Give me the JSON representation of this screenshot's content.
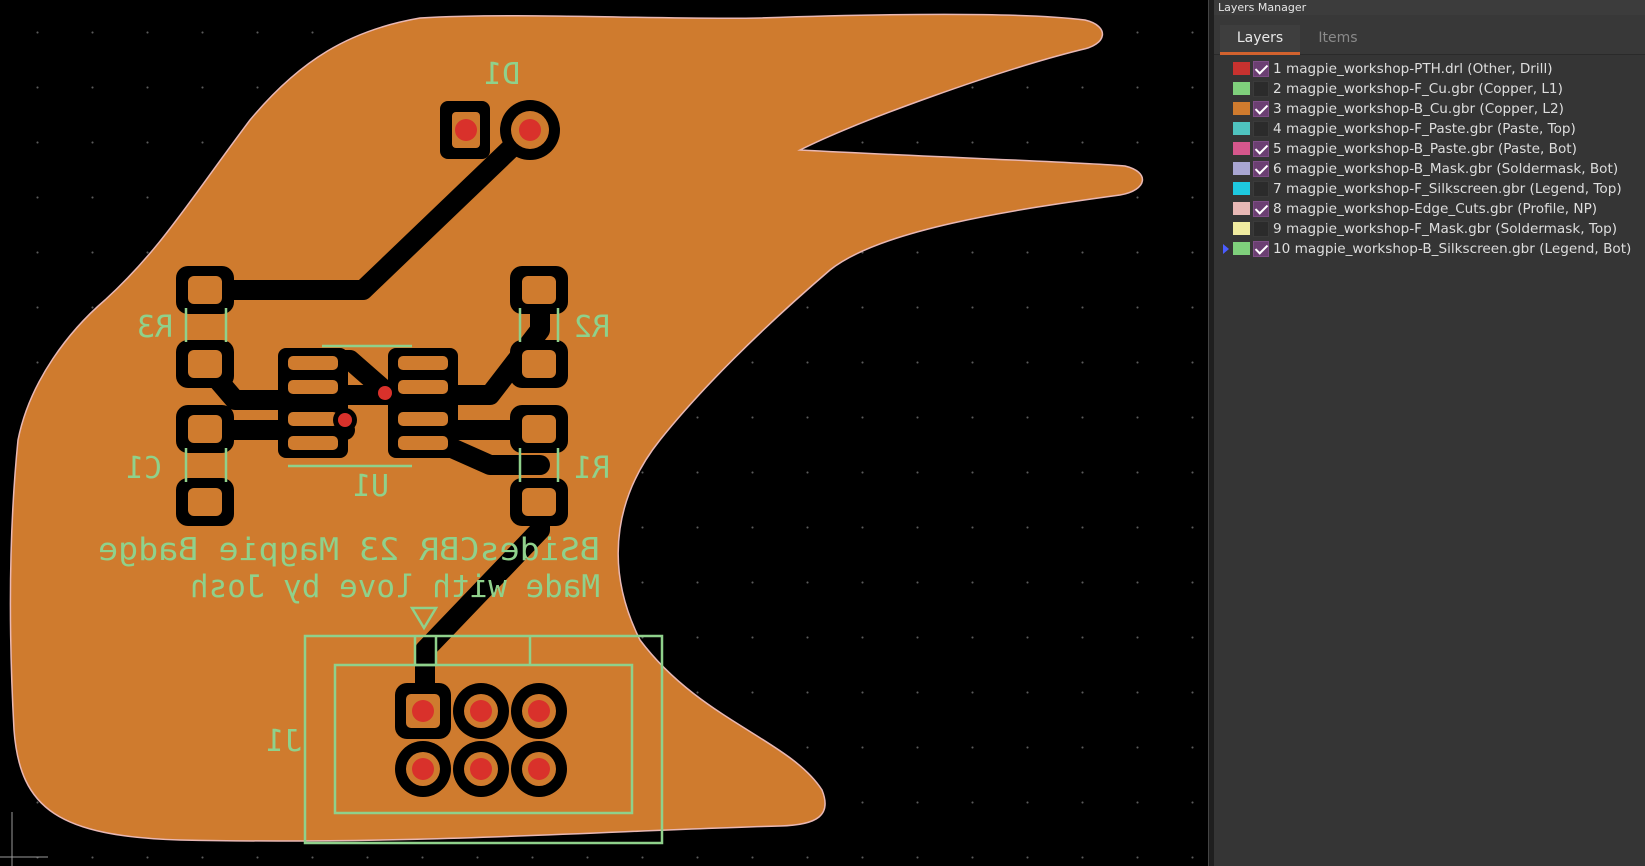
{
  "board": {
    "silkscreen_text": {
      "line1": "BSidesCBR 23 Magpie Badge",
      "line2": "Made with love by Josh"
    },
    "refdes": {
      "d1": "D1",
      "r3": "R3",
      "r2": "R2",
      "c1": "C1",
      "r1": "R1",
      "u1": "U1",
      "j1": "J1"
    }
  },
  "panel": {
    "title": "Layers Manager",
    "tabs": [
      {
        "label": "Layers"
      },
      {
        "label": "Items"
      }
    ],
    "layers": [
      {
        "label": "1 magpie_workshop-PTH.drl (Other, Drill)",
        "color": "#c8322f",
        "checked": true
      },
      {
        "label": "2 magpie_workshop-F_Cu.gbr (Copper, L1)",
        "color": "#7fd07c",
        "checked": false
      },
      {
        "label": "3 magpie_workshop-B_Cu.gbr (Copper, L2)",
        "color": "#cf7b2e",
        "checked": true
      },
      {
        "label": "4 magpie_workshop-F_Paste.gbr (Paste, Top)",
        "color": "#4fc3bf",
        "checked": false
      },
      {
        "label": "5 magpie_workshop-B_Paste.gbr (Paste, Bot)",
        "color": "#d6578c",
        "checked": true
      },
      {
        "label": "6 magpie_workshop-B_Mask.gbr (Soldermask, Bot)",
        "color": "#a9a6d2",
        "checked": true
      },
      {
        "label": "7 magpie_workshop-F_Silkscreen.gbr (Legend, Top)",
        "color": "#1ec9e0",
        "checked": false
      },
      {
        "label": "8 magpie_workshop-Edge_Cuts.gbr (Profile, NP)",
        "color": "#e8b8b5",
        "checked": true
      },
      {
        "label": "9 magpie_workshop-F_Mask.gbr (Soldermask, Top)",
        "color": "#f0eba0",
        "checked": false
      },
      {
        "label": "10 magpie_workshop-B_Silkscreen.gbr (Legend, Bot)",
        "color": "#7fd07c",
        "checked": true,
        "active": true
      }
    ]
  },
  "colors": {
    "copper": "#cf7b2e",
    "silkscreen": "#8fd18b",
    "drill": "#d9312b",
    "edge_cuts": "#e8b8b5",
    "accent_tab": "#d2622e"
  }
}
